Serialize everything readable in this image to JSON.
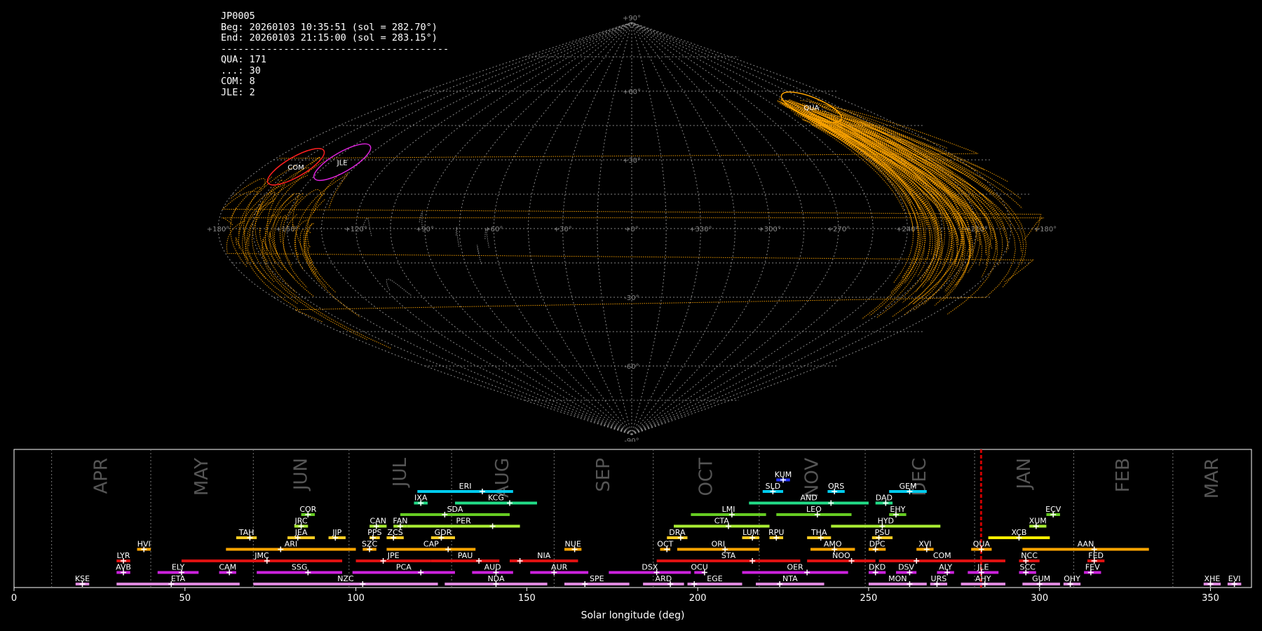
{
  "info_panel": {
    "station": "JP0005",
    "begin": "Beg: 20260103 10:35:51 (sol = 282.70°)",
    "end": "End: 20260103 21:15:00 (sol = 283.15°)",
    "separator": "----------------------------------------",
    "counts": [
      "QUA: 171",
      "...: 30",
      "COM: 8",
      "JLE: 2"
    ]
  },
  "chart_data": [
    {
      "type": "scatter",
      "projection": "sinusoidal",
      "longitude_labels": [
        "+180°",
        "+150°",
        "+120°",
        "+90°",
        "+60°",
        "+30°",
        "+0°",
        "+330°",
        "+300°",
        "+270°",
        "+240°",
        "+210°",
        "+180°"
      ],
      "latitude_labels": [
        "+90°",
        "+60°",
        "+30°",
        "-30°",
        "-60°",
        "-90°"
      ],
      "radiants": [
        {
          "code": "QUA",
          "lon": 230,
          "lat": 53,
          "color": "#ffa500"
        },
        {
          "code": "COM",
          "lon": 164,
          "lat": 27,
          "color": "#ff2020"
        },
        {
          "code": "JLE",
          "lon": 144,
          "lat": 29,
          "color": "#dd22dd"
        }
      ],
      "grid": true
    },
    {
      "type": "timeline",
      "xlabel": "Solar longitude (deg)",
      "xlim": [
        0,
        362
      ],
      "xticks": [
        0,
        50,
        100,
        150,
        200,
        250,
        300,
        350
      ],
      "month_labels": [
        {
          "name": "APR",
          "start": 11,
          "end": 40
        },
        {
          "name": "MAY",
          "start": 40,
          "end": 70
        },
        {
          "name": "JUN",
          "start": 70,
          "end": 98
        },
        {
          "name": "JUL",
          "start": 98,
          "end": 128
        },
        {
          "name": "AUG",
          "start": 128,
          "end": 158
        },
        {
          "name": "SEP",
          "start": 158,
          "end": 187
        },
        {
          "name": "OCT",
          "start": 187,
          "end": 218
        },
        {
          "name": "NOV",
          "start": 218,
          "end": 249
        },
        {
          "name": "DEC",
          "start": 249,
          "end": 281
        },
        {
          "name": "JAN",
          "start": 281,
          "end": 310
        },
        {
          "name": "FEB",
          "start": 310,
          "end": 339
        },
        {
          "name": "MAR",
          "start": 339,
          "end": 362
        }
      ],
      "current_sol": 282.9,
      "current_marker_color": "#cc0000",
      "showers": [
        {
          "code": "KSE",
          "start": 18,
          "end": 22,
          "peak": 20,
          "row": 0,
          "color": "#dd88dd"
        },
        {
          "code": "ETA",
          "start": 30,
          "end": 66,
          "peak": 46,
          "row": 0,
          "color": "#dd88dd"
        },
        {
          "code": "NZC",
          "start": 70,
          "end": 124,
          "peak": 102,
          "row": 0,
          "color": "#dd88dd"
        },
        {
          "code": "NDA",
          "start": 126,
          "end": 156,
          "peak": 141,
          "row": 0,
          "color": "#dd88dd"
        },
        {
          "code": "SPE",
          "start": 161,
          "end": 180,
          "peak": 167,
          "row": 0,
          "color": "#dd88dd"
        },
        {
          "code": "ARD",
          "start": 184,
          "end": 196,
          "peak": 192,
          "row": 0,
          "color": "#dd88dd"
        },
        {
          "code": "EGE",
          "start": 197,
          "end": 213,
          "peak": 199,
          "row": 0,
          "color": "#dd88dd"
        },
        {
          "code": "NTA",
          "start": 217,
          "end": 237,
          "peak": 224,
          "row": 0,
          "color": "#dd88dd"
        },
        {
          "code": "MON",
          "start": 250,
          "end": 267,
          "peak": 262,
          "row": 0,
          "color": "#dd88dd"
        },
        {
          "code": "URS",
          "start": 268,
          "end": 273,
          "peak": 270,
          "row": 0,
          "color": "#dd88dd"
        },
        {
          "code": "AHY",
          "start": 277,
          "end": 290,
          "peak": 284,
          "row": 0,
          "color": "#dd88dd"
        },
        {
          "code": "GUM",
          "start": 295,
          "end": 306,
          "peak": 300,
          "row": 0,
          "color": "#dd88dd"
        },
        {
          "code": "OHY",
          "start": 307,
          "end": 312,
          "peak": 309,
          "row": 0,
          "color": "#dd88dd"
        },
        {
          "code": "XHE",
          "start": 348,
          "end": 353,
          "peak": 350,
          "row": 0,
          "color": "#dd88dd"
        },
        {
          "code": "EVI",
          "start": 355,
          "end": 359,
          "peak": 357,
          "row": 0,
          "color": "#dd88dd"
        },
        {
          "code": "AVB",
          "start": 30,
          "end": 34,
          "peak": 32,
          "row": 1,
          "color": "#cc22dd"
        },
        {
          "code": "ELY",
          "start": 42,
          "end": 54,
          "peak": 49,
          "row": 1,
          "color": "#cc22dd"
        },
        {
          "code": "CAM",
          "start": 60,
          "end": 65,
          "peak": 63,
          "row": 1,
          "color": "#cc22dd"
        },
        {
          "code": "SSG",
          "start": 71,
          "end": 96,
          "peak": 86,
          "row": 1,
          "color": "#cc22dd"
        },
        {
          "code": "PCA",
          "start": 99,
          "end": 129,
          "peak": 119,
          "row": 1,
          "color": "#cc22dd"
        },
        {
          "code": "AUD",
          "start": 134,
          "end": 146,
          "peak": 141,
          "row": 1,
          "color": "#cc22dd"
        },
        {
          "code": "AUR",
          "start": 151,
          "end": 168,
          "peak": 158,
          "row": 1,
          "color": "#cc22dd"
        },
        {
          "code": "DSX",
          "start": 174,
          "end": 198,
          "peak": 188,
          "row": 1,
          "color": "#cc22dd"
        },
        {
          "code": "OCU",
          "start": 199,
          "end": 202,
          "peak": 202,
          "row": 1,
          "color": "#cc22dd"
        },
        {
          "code": "OER",
          "start": 213,
          "end": 244,
          "peak": 232,
          "row": 1,
          "color": "#cc22dd"
        },
        {
          "code": "DKD",
          "start": 250,
          "end": 255,
          "peak": 252,
          "row": 1,
          "color": "#cc22dd"
        },
        {
          "code": "DSV",
          "start": 258,
          "end": 264,
          "peak": 262,
          "row": 1,
          "color": "#cc22dd"
        },
        {
          "code": "ALY",
          "start": 270,
          "end": 275,
          "peak": 273,
          "row": 1,
          "color": "#cc22dd"
        },
        {
          "code": "JLE",
          "start": 279,
          "end": 288,
          "peak": 283,
          "row": 1,
          "color": "#cc22dd"
        },
        {
          "code": "SCC",
          "start": 294,
          "end": 299,
          "peak": 296,
          "row": 1,
          "color": "#cc22dd"
        },
        {
          "code": "FEV",
          "start": 313,
          "end": 318,
          "peak": 315,
          "row": 1,
          "color": "#cc22dd"
        },
        {
          "code": "LYR",
          "start": 30,
          "end": 34,
          "peak": 32,
          "row": 2,
          "color": "#dd1111"
        },
        {
          "code": "JMC",
          "start": 49,
          "end": 96,
          "peak": 74,
          "row": 2,
          "color": "#dd1111"
        },
        {
          "code": "JPE",
          "start": 100,
          "end": 122,
          "peak": 108,
          "row": 2,
          "color": "#dd1111"
        },
        {
          "code": "PAU",
          "start": 122,
          "end": 142,
          "peak": 136,
          "row": 2,
          "color": "#dd1111"
        },
        {
          "code": "NIA",
          "start": 145,
          "end": 165,
          "peak": 148,
          "row": 2,
          "color": "#dd1111"
        },
        {
          "code": "STA",
          "start": 188,
          "end": 230,
          "peak": 216,
          "row": 2,
          "color": "#dd1111"
        },
        {
          "code": "NOO",
          "start": 232,
          "end": 252,
          "peak": 245,
          "row": 2,
          "color": "#dd1111"
        },
        {
          "code": "COM",
          "start": 253,
          "end": 290,
          "peak": 264,
          "row": 2,
          "color": "#dd1111"
        },
        {
          "code": "NCC",
          "start": 294,
          "end": 300,
          "peak": 296,
          "row": 2,
          "color": "#dd1111"
        },
        {
          "code": "FED",
          "start": 314,
          "end": 319,
          "peak": 316,
          "row": 2,
          "color": "#dd1111"
        },
        {
          "code": "HVI",
          "start": 36,
          "end": 40,
          "peak": 38,
          "row": 3,
          "color": "#ffa500"
        },
        {
          "code": "ARI",
          "start": 62,
          "end": 100,
          "peak": 78,
          "row": 3,
          "color": "#ffa500"
        },
        {
          "code": "SZC",
          "start": 102,
          "end": 106,
          "peak": 104,
          "row": 3,
          "color": "#ffa500"
        },
        {
          "code": "CAP",
          "start": 109,
          "end": 135,
          "peak": 127,
          "row": 3,
          "color": "#ffa500"
        },
        {
          "code": "NUE",
          "start": 161,
          "end": 166,
          "peak": 164,
          "row": 3,
          "color": "#ffa500"
        },
        {
          "code": "OCT",
          "start": 189,
          "end": 192,
          "peak": 191,
          "row": 3,
          "color": "#ffa500"
        },
        {
          "code": "ORI",
          "start": 194,
          "end": 218,
          "peak": 208,
          "row": 3,
          "color": "#ffa500"
        },
        {
          "code": "AMO",
          "start": 233,
          "end": 246,
          "peak": 240,
          "row": 3,
          "color": "#ffa500"
        },
        {
          "code": "DPC",
          "start": 250,
          "end": 255,
          "peak": 252,
          "row": 3,
          "color": "#ffa500"
        },
        {
          "code": "XVI",
          "start": 264,
          "end": 269,
          "peak": 267,
          "row": 3,
          "color": "#ffa500"
        },
        {
          "code": "QUA",
          "start": 280,
          "end": 286,
          "peak": 283,
          "row": 3,
          "color": "#ffa500"
        },
        {
          "code": "AAN",
          "start": 295,
          "end": 332,
          "peak": 316,
          "row": 3,
          "color": "#ffa500"
        },
        {
          "code": "TAH",
          "start": 65,
          "end": 71,
          "peak": 69,
          "row": 4,
          "color": "#ffcc22"
        },
        {
          "code": "JEA",
          "start": 80,
          "end": 88,
          "peak": 83,
          "row": 4,
          "color": "#ffcc22"
        },
        {
          "code": "JIP",
          "start": 92,
          "end": 97,
          "peak": 94,
          "row": 4,
          "color": "#ffcc22"
        },
        {
          "code": "PPS",
          "start": 104,
          "end": 107,
          "peak": 105,
          "row": 4,
          "color": "#ffcc22"
        },
        {
          "code": "ZCS",
          "start": 109,
          "end": 114,
          "peak": 111,
          "row": 4,
          "color": "#ffcc22"
        },
        {
          "code": "GDR",
          "start": 122,
          "end": 129,
          "peak": 125,
          "row": 4,
          "color": "#ffcc22"
        },
        {
          "code": "DRA",
          "start": 191,
          "end": 197,
          "peak": 195,
          "row": 4,
          "color": "#ffcc22"
        },
        {
          "code": "LUM",
          "start": 213,
          "end": 218,
          "peak": 216,
          "row": 4,
          "color": "#ffcc22"
        },
        {
          "code": "RPU",
          "start": 221,
          "end": 225,
          "peak": 223,
          "row": 4,
          "color": "#ffcc22"
        },
        {
          "code": "THA",
          "start": 232,
          "end": 239,
          "peak": 236,
          "row": 4,
          "color": "#ffcc22"
        },
        {
          "code": "PSU",
          "start": 251,
          "end": 257,
          "peak": 253,
          "row": 4,
          "color": "#ffcc22"
        },
        {
          "code": "XCB",
          "start": 285,
          "end": 303,
          "peak": 294,
          "row": 4,
          "color": "#ffee00"
        },
        {
          "code": "JRC",
          "start": 82,
          "end": 86,
          "peak": 84,
          "row": 5,
          "color": "#aaee33"
        },
        {
          "code": "CAN",
          "start": 104,
          "end": 109,
          "peak": 106,
          "row": 5,
          "color": "#aaee33"
        },
        {
          "code": "FAN",
          "start": 111,
          "end": 115,
          "peak": 113,
          "row": 5,
          "color": "#aaee33"
        },
        {
          "code": "PER",
          "start": 115,
          "end": 148,
          "peak": 140,
          "row": 5,
          "color": "#aaee33"
        },
        {
          "code": "CTA",
          "start": 193,
          "end": 221,
          "peak": 209,
          "row": 5,
          "color": "#aaee33"
        },
        {
          "code": "HYD",
          "start": 239,
          "end": 271,
          "peak": 254,
          "row": 5,
          "color": "#aaee33"
        },
        {
          "code": "XUM",
          "start": 297,
          "end": 302,
          "peak": 299,
          "row": 5,
          "color": "#aaee33"
        },
        {
          "code": "COR",
          "start": 84,
          "end": 88,
          "peak": 86,
          "row": 6,
          "color": "#66cc22"
        },
        {
          "code": "SDA",
          "start": 113,
          "end": 145,
          "peak": 126,
          "row": 6,
          "color": "#66cc22"
        },
        {
          "code": "LMI",
          "start": 198,
          "end": 220,
          "peak": 210,
          "row": 6,
          "color": "#66cc22"
        },
        {
          "code": "LEO",
          "start": 223,
          "end": 245,
          "peak": 235,
          "row": 6,
          "color": "#66cc22"
        },
        {
          "code": "EHY",
          "start": 256,
          "end": 261,
          "peak": 258,
          "row": 6,
          "color": "#66cc22"
        },
        {
          "code": "ECV",
          "start": 302,
          "end": 306,
          "peak": 304,
          "row": 6,
          "color": "#66cc22"
        },
        {
          "code": "IXA",
          "start": 117,
          "end": 121,
          "peak": 119,
          "row": 7,
          "color": "#22dd88"
        },
        {
          "code": "KCG",
          "start": 129,
          "end": 153,
          "peak": 145,
          "row": 7,
          "color": "#22dd88"
        },
        {
          "code": "AND",
          "start": 215,
          "end": 250,
          "peak": 239,
          "row": 7,
          "color": "#22dd88"
        },
        {
          "code": "DAD",
          "start": 252,
          "end": 257,
          "peak": 255,
          "row": 7,
          "color": "#22dd88"
        },
        {
          "code": "ERI",
          "start": 118,
          "end": 146,
          "peak": 137,
          "row": 8,
          "color": "#00ccee"
        },
        {
          "code": "SLD",
          "start": 219,
          "end": 225,
          "peak": 222,
          "row": 8,
          "color": "#00ccee"
        },
        {
          "code": "ORS",
          "start": 238,
          "end": 243,
          "peak": 240,
          "row": 8,
          "color": "#00ccee"
        },
        {
          "code": "GEM",
          "start": 256,
          "end": 267,
          "peak": 262,
          "row": 8,
          "color": "#00ccee"
        },
        {
          "code": "KUM",
          "start": 223,
          "end": 227,
          "peak": 225,
          "row": 9,
          "color": "#2233ff"
        }
      ]
    }
  ]
}
